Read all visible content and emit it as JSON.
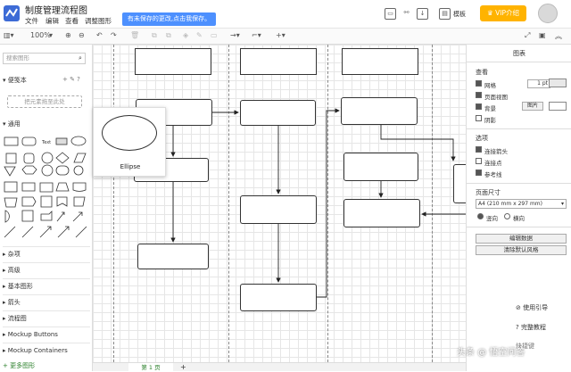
{
  "app": {
    "title": "制度管理流程图",
    "menus": [
      "文件",
      "编辑",
      "查看",
      "调整图形"
    ],
    "unsaved_notice": "有未保存的更改,点击我保存。",
    "template_label": "模板",
    "vip_label": "VIP介绍"
  },
  "toolbar": {
    "zoom": "100%"
  },
  "sidebar": {
    "search_placeholder": "搜索图形",
    "scratchpad_label": "便笺本",
    "scratchpad_drop": "把元素拖至此处",
    "general_label": "通用",
    "categories": [
      "杂项",
      "高级",
      "基本图形",
      "箭头",
      "流程图",
      "Mockup Buttons",
      "Mockup Containers"
    ],
    "more_shapes": "更多图形"
  },
  "tooltip": {
    "shape_name": "Ellipse"
  },
  "page": {
    "tab_label": "第 1 页"
  },
  "right_panel": {
    "tab": "图表",
    "view_section": "查看",
    "grid_label": "网格",
    "grid_size": "1 pt",
    "page_view_label": "页面视图",
    "background_label": "背景",
    "image_button": "图片",
    "shadow_label": "阴影",
    "options_section": "选项",
    "connection_arrows_label": "连接箭头",
    "connection_points_label": "连接点",
    "guides_label": "参考线",
    "paper_size_section": "页面尺寸",
    "paper_size_value": "A4 (210 mm x 297 mm)",
    "portrait_label": "竖向",
    "landscape_label": "横向",
    "edit_data_button": "编辑数据",
    "clear_default_style_button": "清除默认风格"
  },
  "floating": {
    "guide": "使用引导",
    "full_tutorial": "完整教程",
    "shortcut": "快捷键"
  },
  "watermark": "头条 @ 悟空问答",
  "colors": {
    "primary": "#4d90fe",
    "vip": "#ffb300",
    "logo": "#3d6bd6"
  }
}
